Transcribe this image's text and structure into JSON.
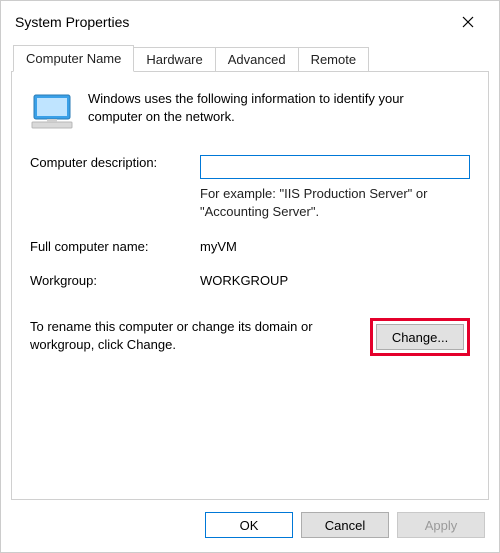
{
  "window": {
    "title": "System Properties"
  },
  "tabs": {
    "computer_name": "Computer Name",
    "hardware": "Hardware",
    "advanced": "Advanced",
    "remote": "Remote"
  },
  "panel": {
    "intro": "Windows uses the following information to identify your computer on the network.",
    "desc_label": "Computer description:",
    "desc_value": "",
    "example": "For example: \"IIS Production Server\" or \"Accounting Server\".",
    "full_name_label": "Full computer name:",
    "full_name_value": "myVM",
    "workgroup_label": "Workgroup:",
    "workgroup_value": "WORKGROUP",
    "rename_text": "To rename this computer or change its domain or workgroup, click Change.",
    "change_btn": "Change..."
  },
  "buttons": {
    "ok": "OK",
    "cancel": "Cancel",
    "apply": "Apply"
  }
}
